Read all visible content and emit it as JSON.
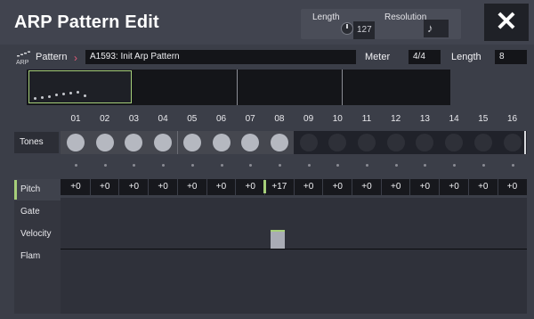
{
  "header": {
    "title": "ARP Pattern Edit",
    "length_label": "Length",
    "length_value": "127",
    "resolution_label": "Resolution",
    "resolution_value": "♪",
    "close_label": "✕"
  },
  "pattern": {
    "icon_text": "ARP",
    "label": "Pattern",
    "chevron": "›",
    "name": "A1593: Init Arp Pattern",
    "meter_label": "Meter",
    "meter_value": "4/4",
    "length_label": "Length",
    "length_value": "8"
  },
  "steps": [
    "01",
    "02",
    "03",
    "04",
    "05",
    "06",
    "07",
    "08",
    "09",
    "10",
    "11",
    "12",
    "13",
    "14",
    "15",
    "16"
  ],
  "tones": {
    "label": "Tones",
    "active_count": 8
  },
  "params": {
    "tabs": [
      "Pitch",
      "Gate",
      "Velocity",
      "Flam"
    ],
    "active_tab": "Pitch"
  },
  "pitch_values": [
    "+0",
    "+0",
    "+0",
    "+0",
    "+0",
    "+0",
    "+0",
    "+17",
    "+0",
    "+0",
    "+0",
    "+0",
    "+0",
    "+0",
    "+0",
    "+0"
  ],
  "colors": {
    "accent_green": "#a6cf7a",
    "accent_pink": "#e25a78",
    "background": "#3b3e48"
  }
}
